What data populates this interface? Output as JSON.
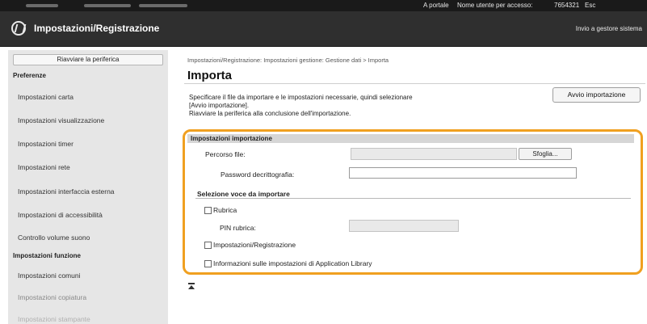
{
  "topbar": {
    "portal_link": "A portale",
    "user_label": "Nome utente per accesso:",
    "user_id": "7654321",
    "logout": "Esc"
  },
  "header": {
    "app_title": "Impostazioni/Registrazione",
    "send_to_admin": "Invio a gestore sistema"
  },
  "sidebar": {
    "restart_button": "Riavviare la periferica",
    "section1_title": "Preferenze",
    "section1_items": [
      "Impostazioni carta",
      "Impostazioni visualizzazione",
      "Impostazioni timer",
      "Impostazioni rete",
      "Impostazioni interfaccia esterna",
      "Impostazioni di accessibilità",
      "Controllo volume suono"
    ],
    "section2_title": "Impostazioni funzione",
    "section2_items": [
      "Impostazioni comuni",
      "Impostazioni copiatura",
      "Impostazioni stampante"
    ]
  },
  "main": {
    "breadcrumb": "Impostazioni/Registrazione: Impostazioni gestione: Gestione dati > Importa",
    "title": "Importa",
    "description_line1": "Specificare il file da importare e le impostazioni necessarie, quindi selezionare",
    "description_line2": "[Avvio importazione].",
    "description_line3": "Riavviare la periferica alla conclusione dell'importazione.",
    "start_button": "Avvio importazione",
    "import_settings": {
      "section_title": "Impostazioni importazione",
      "file_path_label": "Percorso file:",
      "file_path_value": "",
      "browse_button": "Sfoglia...",
      "password_label": "Password decrittografia:",
      "password_value": "",
      "items_title": "Selezione voce da importare",
      "address_book_label": "Rubrica",
      "address_book_checked": false,
      "pin_label": "PIN rubrica:",
      "pin_value": "",
      "settings_reg_label": "Impostazioni/Registrazione",
      "settings_reg_checked": false,
      "app_library_label": "Informazioni sulle impostazioni di Application Library",
      "app_library_checked": false
    }
  },
  "colors": {
    "highlight": "#f0a020",
    "header_bg": "#2f2f2f",
    "sidebar_bg": "#e6e6e6"
  },
  "icons": {
    "logo": "product-logo-icon",
    "back_to_top": "back-to-top-icon"
  }
}
